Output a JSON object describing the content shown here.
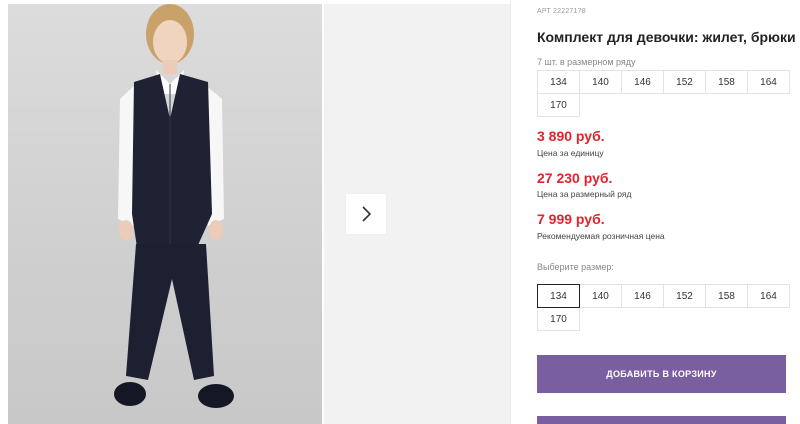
{
  "product": {
    "art": "АРТ 22227178",
    "title": "Комплект для девочки: жилет, брюки",
    "size_row_note": "7 шт. в размерном ряду",
    "size_row": [
      "134",
      "140",
      "146",
      "152",
      "158",
      "164",
      "170"
    ]
  },
  "prices": [
    {
      "value": "3 890 руб.",
      "note": "Цена за единицу"
    },
    {
      "value": "27 230 руб.",
      "note": "Цена за размерный ряд"
    },
    {
      "value": "7 999 руб.",
      "note": "Рекомендуемая розничная цена"
    }
  ],
  "size_select": {
    "label": "Выберите размер:",
    "options": [
      "134",
      "140",
      "146",
      "152",
      "158",
      "164",
      "170"
    ],
    "selected": "134"
  },
  "actions": {
    "add_to_cart": "ДОБАВИТЬ В КОРЗИНУ"
  },
  "colors": {
    "accent": "#7a5fa0",
    "price": "#e0242e"
  },
  "icons": {
    "next": "chevron-right-icon"
  }
}
